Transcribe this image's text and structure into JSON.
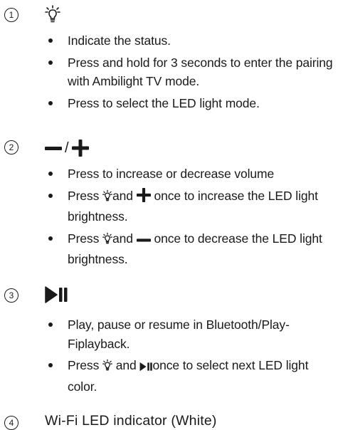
{
  "sections": [
    {
      "number": "1",
      "icon": "light-bulb-icon",
      "bullets": [
        "Indicate the status.",
        "Press and hold for 3 seconds to enter the pairing with Ambilight TV mode.",
        "Press to select the LED light mode."
      ]
    },
    {
      "number": "2",
      "icon": "minus-plus-icon",
      "separator": "/",
      "bullets": {
        "b1": "Press to increase or decrease volume",
        "b2_pre": "Press",
        "b2_mid": "and",
        "b2_post": "once to increase the LED light brightness.",
        "b3_pre": "Press",
        "b3_mid": "and",
        "b3_post": "once to decrease the LED light brightness."
      }
    },
    {
      "number": "3",
      "icon": "play-pause-icon",
      "bullets": {
        "b1": "Play, pause or resume in Bluetooth/Play-Fiplayback.",
        "b2_pre": "Press",
        "b2_mid": "and",
        "b2_post": "once to select next LED light color."
      }
    },
    {
      "number": "4",
      "title": "Wi-Fi LED indicator (White)"
    }
  ]
}
